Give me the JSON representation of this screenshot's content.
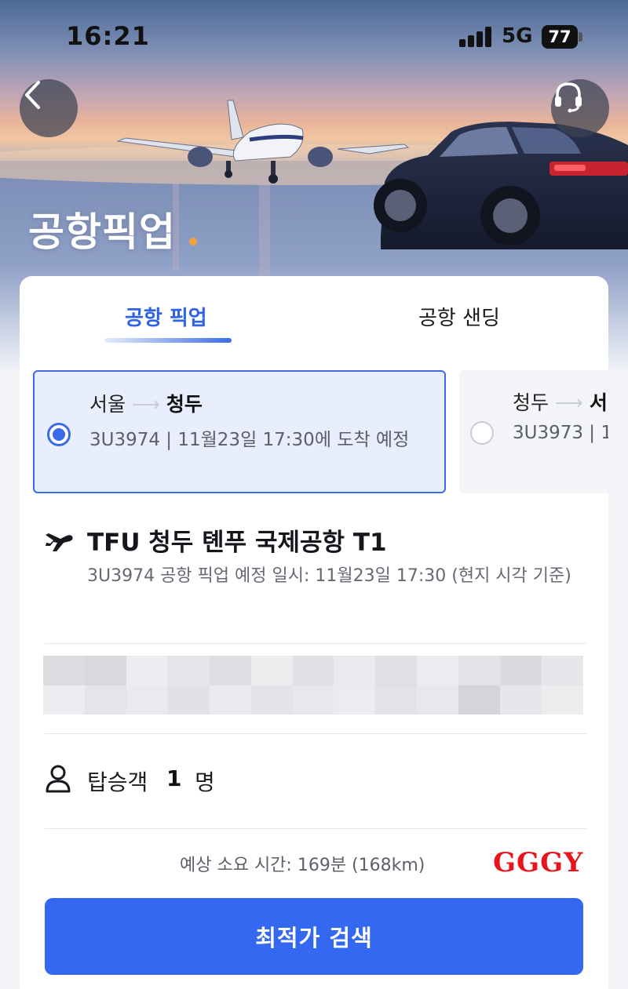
{
  "status_bar": {
    "time": "16:21",
    "network": "5G",
    "battery": "77"
  },
  "header": {
    "title": "공항픽업",
    "back_icon": "chevron-left-icon",
    "support_icon": "headset-icon"
  },
  "tabs": [
    {
      "label": "공항 픽업",
      "active": true
    },
    {
      "label": "공항 샌딩",
      "active": false
    }
  ],
  "flights": [
    {
      "from": "서울",
      "to": "청두",
      "info": "3U3974 | 11월23일 17:30에 도착 예정",
      "selected": true
    },
    {
      "from": "청두",
      "to": "서",
      "info": "3U3973 | 1",
      "selected": false
    }
  ],
  "airport": {
    "name": "TFU 청두 톈푸 국제공항 T1",
    "note": "3U3974 공항 픽업 예정 일시: 11월23일 17:30 (현지 시각 기준)"
  },
  "passengers": {
    "label": "탑승객",
    "count": "1",
    "unit": "명"
  },
  "duration": "예상 소요 시간: 169분 (168km)",
  "watermark": "GGGY",
  "search_button": "최적가 검색",
  "colors": {
    "accent": "#3568f0",
    "selected_bg": "#e8eefd",
    "watermark": "#e8141b"
  }
}
